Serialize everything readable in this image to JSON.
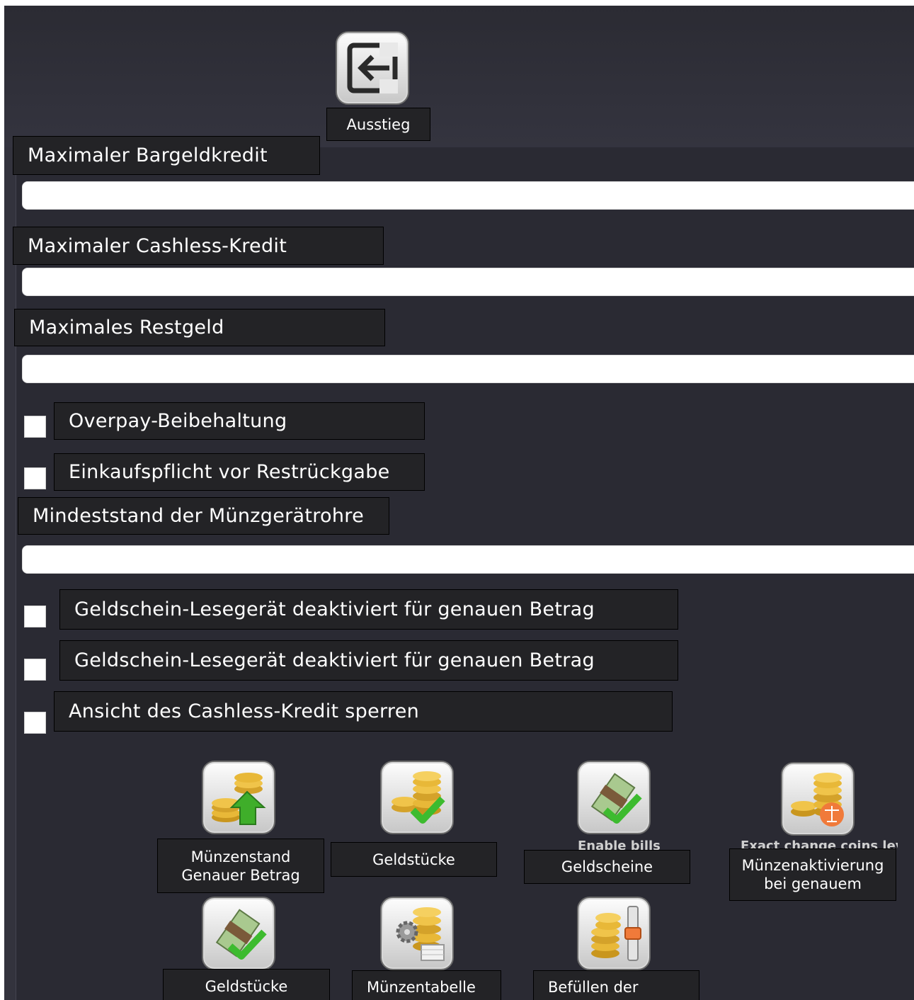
{
  "header": {
    "exit_label": "Ausstieg"
  },
  "settings": {
    "max_cash_credit": {
      "label": "Maximaler Bargeldkredit",
      "value": ""
    },
    "max_cashless_credit": {
      "label": "Maximaler Cashless-Kredit",
      "value": ""
    },
    "max_change": {
      "label": "Maximales Restgeld",
      "value": ""
    },
    "overpay_retention": {
      "label": "Overpay-Beibehaltung",
      "checked": false
    },
    "purchase_before_change": {
      "label": "Einkaufspflicht vor Restrückgabe",
      "checked": false
    },
    "min_coin_tube_level": {
      "label": "Mindeststand der Münzgerätrohre",
      "value": ""
    },
    "bill_reader_disabled_exact_1": {
      "label": "Geldschein-Lesegerät deaktiviert für genauen Betrag",
      "checked": false
    },
    "bill_reader_disabled_exact_2": {
      "label": "Geldschein-Lesegerät deaktiviert für genauen Betrag",
      "checked": false
    },
    "lock_cashless_view": {
      "label": "Ansicht des Cashless-Kredit sperren",
      "checked": false
    }
  },
  "actions": {
    "coin_level_exact": {
      "label": "Münzenstand Genauer Betrag",
      "icon": "coins-up-arrow-icon"
    },
    "enable_coins": {
      "label": "Geldstücke",
      "icon": "coins-check-icon"
    },
    "enable_bills": {
      "label": "Geldscheine",
      "ghost": "Enable bills",
      "icon": "bills-check-icon"
    },
    "exact_change_coins_level": {
      "label": "Münzenaktivierung bei genauem",
      "ghost": "Exact change coins level",
      "icon": "coins-scale-icon"
    },
    "bills_coins": {
      "label": "Geldstücke",
      "icon": "bills-check-icon"
    },
    "coin_table": {
      "label": "Münzentabelle",
      "icon": "coins-gear-icon"
    },
    "fill_tubes": {
      "label": "Befüllen der",
      "icon": "coins-fill-icon"
    }
  },
  "colors": {
    "background": "#2a2a33",
    "label_bg": "#232326",
    "check_green": "#3dbb2f",
    "arrow_green": "#3fae2a",
    "scale_orange": "#f07a3a"
  }
}
